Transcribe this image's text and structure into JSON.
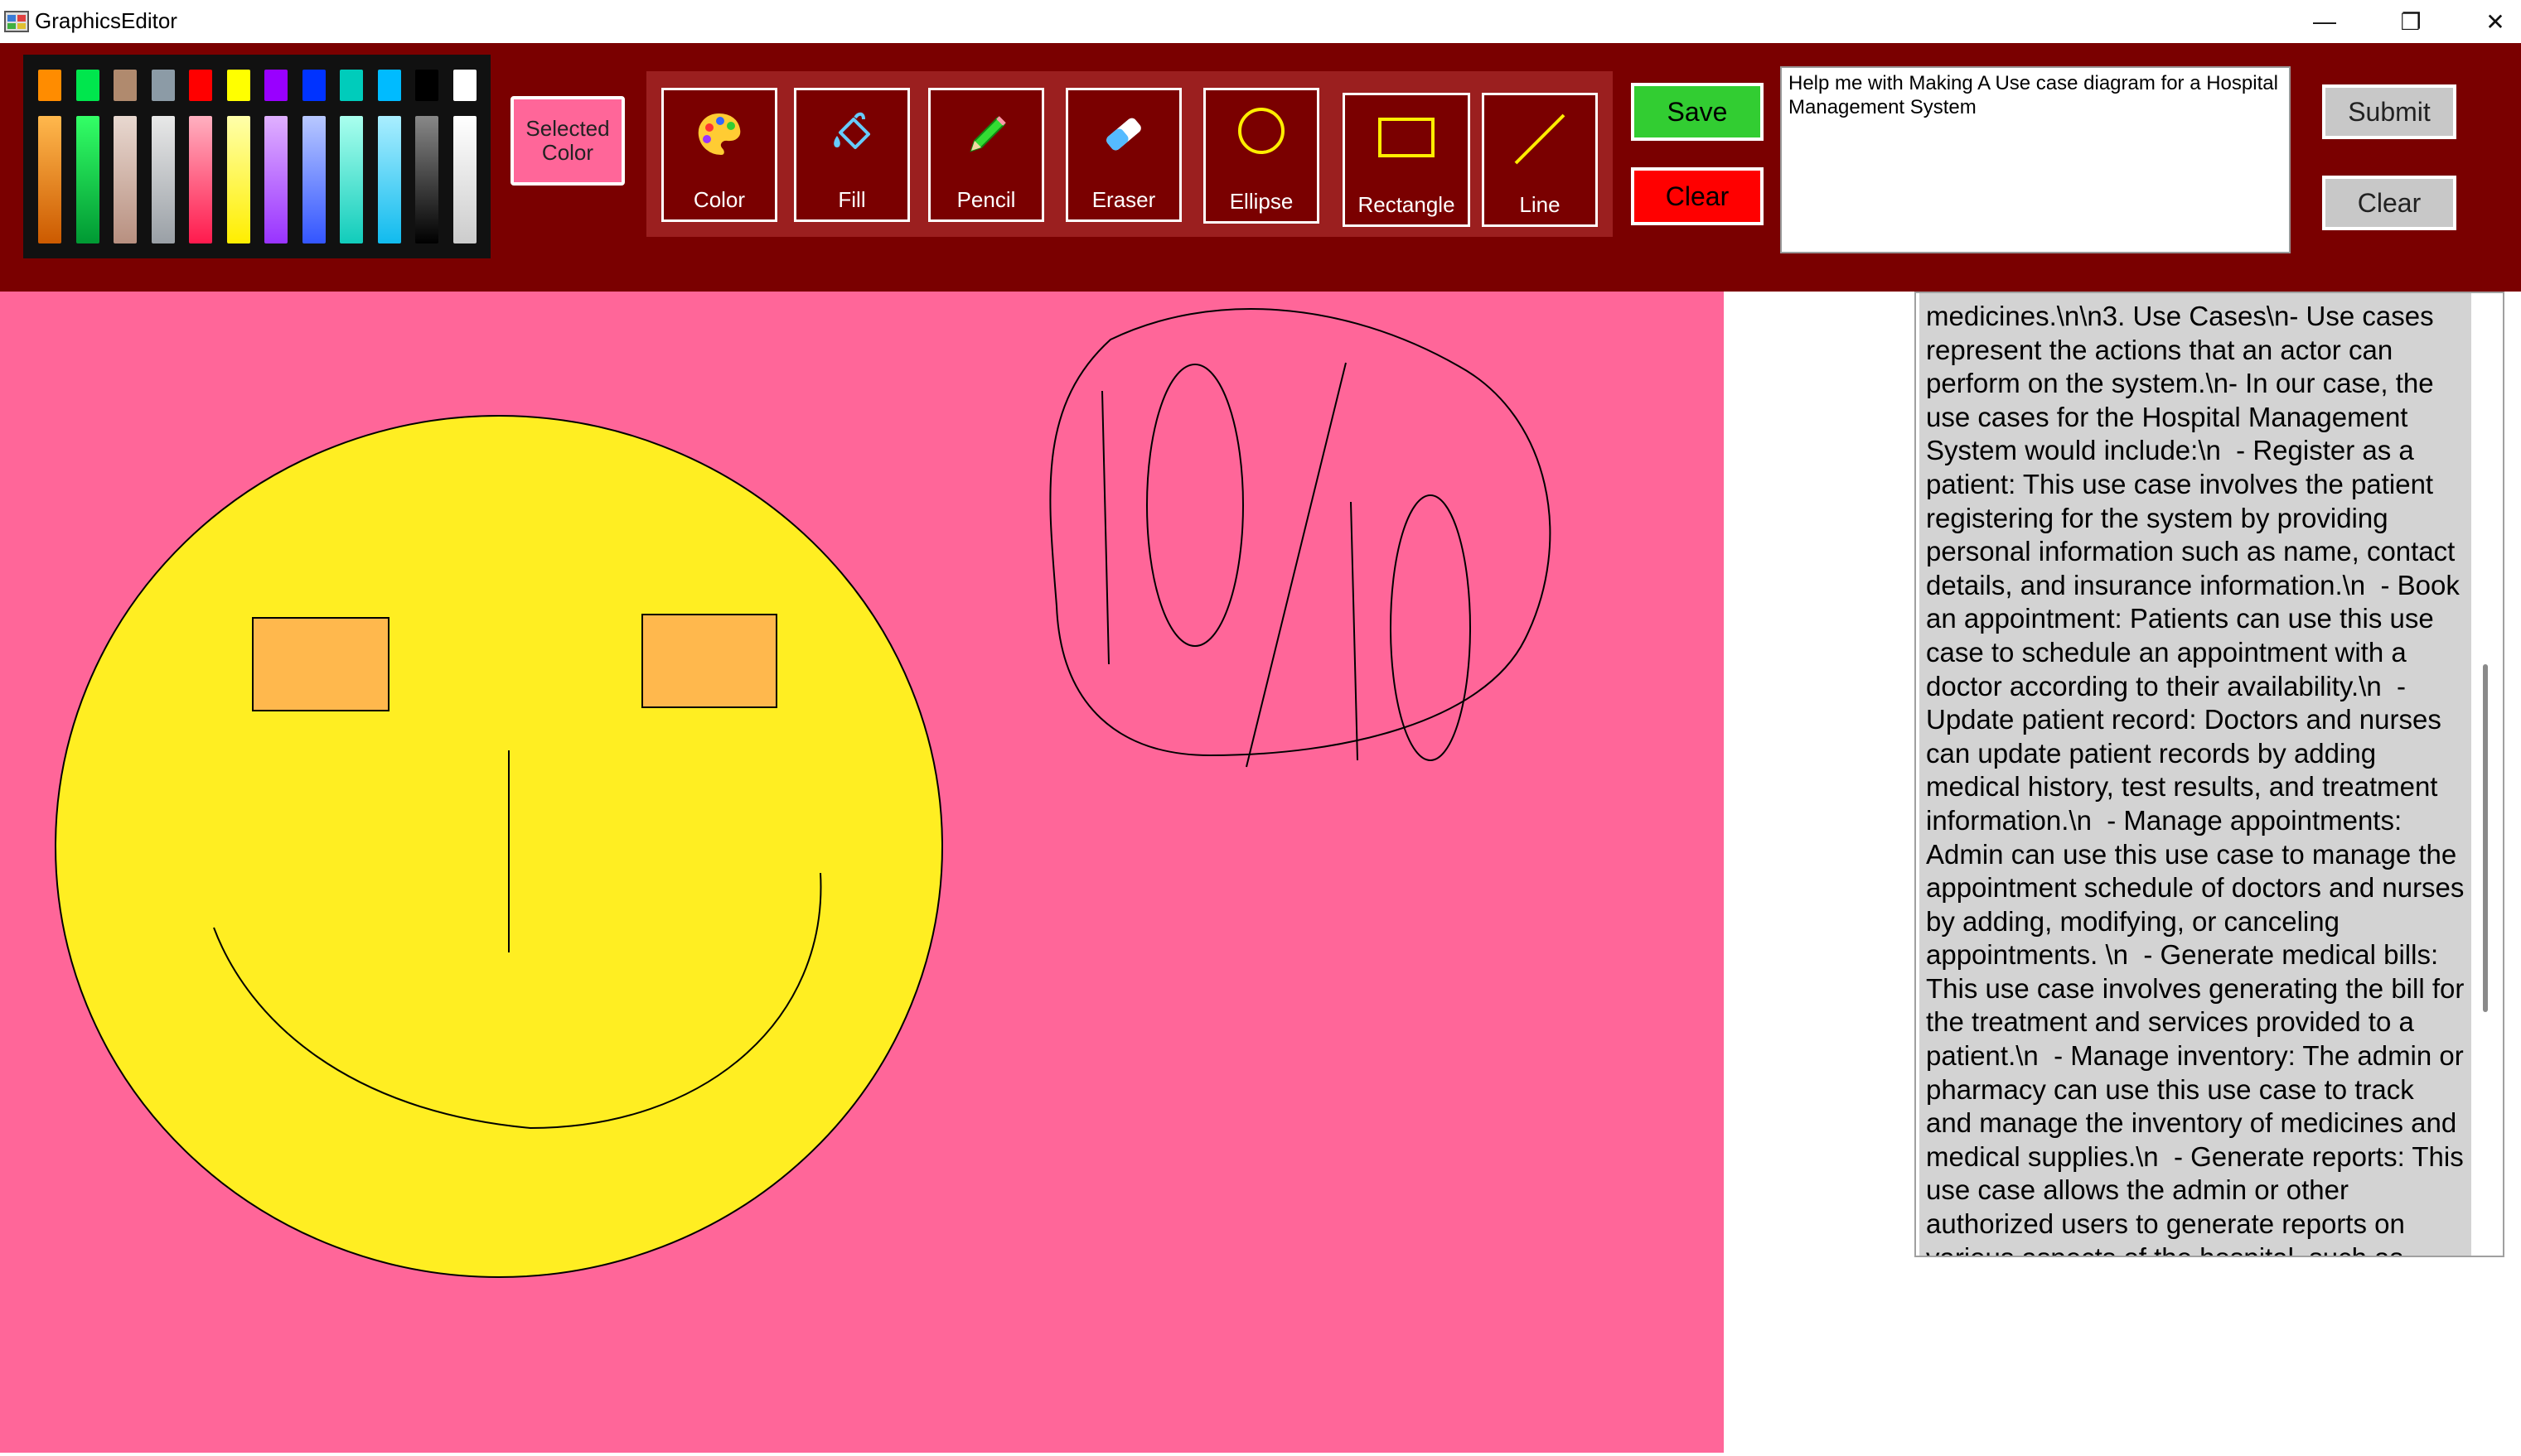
{
  "window": {
    "title": "GraphicsEditor",
    "minimize_glyph": "—",
    "maximize_glyph": "❐",
    "close_glyph": "✕"
  },
  "palette": {
    "top_colors": [
      "#ff8c00",
      "#00e64d",
      "#b08a6e",
      "#8c9ba6",
      "#ff0000",
      "#ffff00",
      "#9900ff",
      "#0033ff",
      "#00ccbb",
      "#00bbff",
      "#000000",
      "#ffffff"
    ],
    "columns": [
      [
        "#ffb84d",
        "#cc5a00"
      ],
      [
        "#33ff66",
        "#009933"
      ],
      [
        "#e8d8d0",
        "#b89080"
      ],
      [
        "#e8e8e8",
        "#9aa0a6"
      ],
      [
        "#ffb0c0",
        "#ff1a4d"
      ],
      [
        "#ffffaa",
        "#ffee00"
      ],
      [
        "#e0b0ff",
        "#9933ff"
      ],
      [
        "#b8c8ff",
        "#3355ff"
      ],
      [
        "#aaffee",
        "#11ccbb"
      ],
      [
        "#aaeeff",
        "#11bbee"
      ],
      [
        "#888888",
        "#000000"
      ],
      [
        "#ffffff",
        "#cccccc"
      ]
    ]
  },
  "selected_color": {
    "label": "Selected Color",
    "value": "#ff6699"
  },
  "tools": [
    {
      "id": "color",
      "label": "Color",
      "icon": "palette-icon"
    },
    {
      "id": "fill",
      "label": "Fill",
      "icon": "fill-bucket-icon"
    },
    {
      "id": "pencil",
      "label": "Pencil",
      "icon": "pencil-icon"
    },
    {
      "id": "eraser",
      "label": "Eraser",
      "icon": "eraser-icon"
    },
    {
      "id": "ellipse",
      "label": "Ellipse",
      "icon": "ellipse-icon"
    },
    {
      "id": "rectangle",
      "label": "Rectangle",
      "icon": "rectangle-icon"
    },
    {
      "id": "line",
      "label": "Line",
      "icon": "line-icon"
    }
  ],
  "actions": {
    "save_label": "Save",
    "clear_label": "Clear",
    "submit_label": "Submit",
    "clear_prompt_label": "Clear"
  },
  "prompt": {
    "value": "Help me with Making A Use case diagram for a Hospital Management System"
  },
  "canvas": {
    "background": "#ff6699",
    "face_color": "#ffee22",
    "eye_color": "#ffb84d"
  },
  "response": {
    "text": "medicines.\\n\\n3. Use Cases\\n- Use cases represent the actions that an actor can perform on the system.\\n- In our case, the use cases for the Hospital Management System would include:\\n  - Register as a patient: This use case involves the patient registering for the system by providing personal information such as name, contact details, and insurance information.\\n  - Book an appointment: Patients can use this use case to schedule an appointment with a doctor according to their availability.\\n  - Update patient record: Doctors and nurses can update patient records by adding medical history, test results, and treatment information.\\n  - Manage appointments: Admin can use this use case to manage the appointment schedule of doctors and nurses by adding, modifying, or canceling appointments. \\n  - Generate medical bills: This use case involves generating the bill for the treatment and services provided to a patient.\\n  - Manage inventory: The admin or pharmacy can use this use case to track and manage the inventory of medicines and medical supplies.\\n  - Generate reports: This use case allows the admin or other authorized users to generate reports on various aspects of the hospital, such as"
  }
}
